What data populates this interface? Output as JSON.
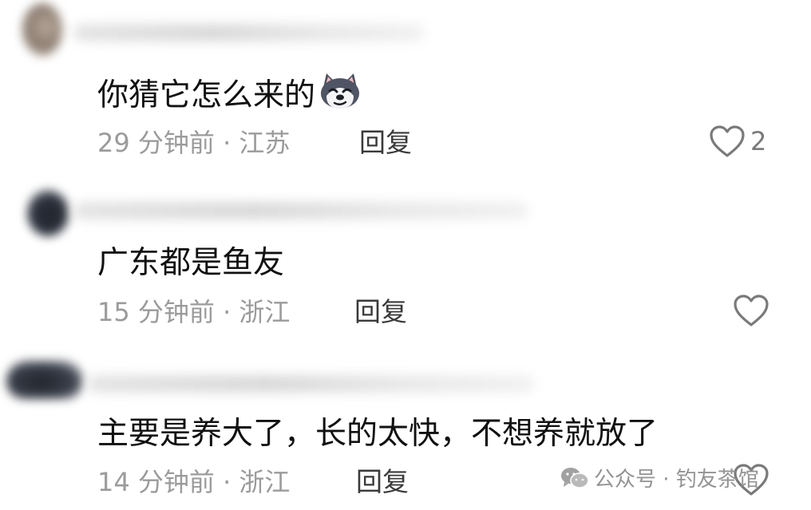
{
  "comments": [
    {
      "text": "你猜它怎么来的",
      "emoji": "husky-dog-emoji",
      "time": "29 分钟前",
      "location": "江苏",
      "reply_label": "回复",
      "like_count": "2",
      "avatar_color": "#8a7a6e"
    },
    {
      "text": "广东都是鱼友",
      "time": "15 分钟前",
      "location": "浙江",
      "reply_label": "回复",
      "like_count": "",
      "avatar_color": "#2f3440"
    },
    {
      "text": "主要是养大了，长的太快，不想养就放了",
      "time": "14 分钟前",
      "location": "浙江",
      "reply_label": "回复",
      "like_count": "",
      "avatar_color": "#3a3f4a"
    }
  ],
  "meta_separator": "·",
  "watermark": {
    "icon": "wechat-icon",
    "text": "公众号 · 钓友茶馆"
  },
  "colors": {
    "text": "#111111",
    "meta": "#9b9b9b",
    "reply": "#3a3a3a",
    "heart": "#7a7a7a"
  }
}
